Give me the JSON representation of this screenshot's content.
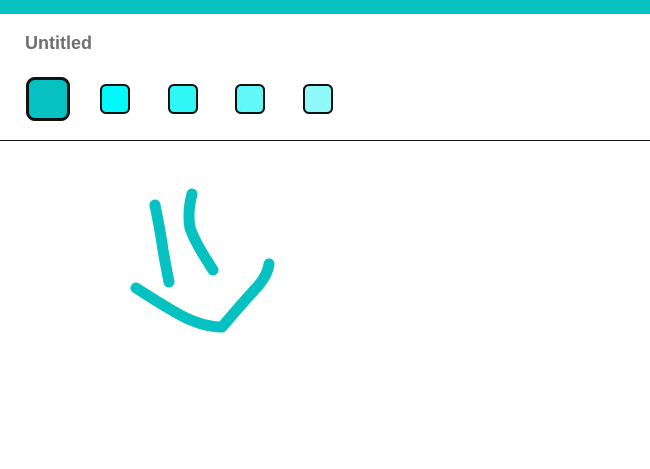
{
  "document": {
    "title": "Untitled"
  },
  "palette": {
    "swatches": [
      {
        "color": "#06c1c1",
        "selected": true
      },
      {
        "color": "#00fafa",
        "selected": false
      },
      {
        "color": "#30f6f6",
        "selected": false
      },
      {
        "color": "#60f8f8",
        "selected": false
      },
      {
        "color": "#90fafa",
        "selected": false
      }
    ]
  },
  "colors": {
    "accent": "#06c1c1",
    "title_text": "#6f6f6f",
    "stroke": "#06c1c1"
  }
}
